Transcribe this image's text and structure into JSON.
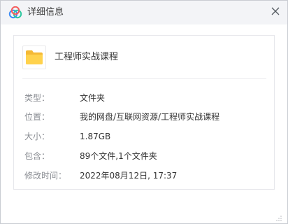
{
  "window": {
    "title": "详细信息",
    "app_icon": "baidu-netdisk-logo-icon",
    "close_icon": "close-icon"
  },
  "file": {
    "icon": "folder-icon",
    "name": "工程师实战课程"
  },
  "details": [
    {
      "label": "类型：",
      "value": "文件夹"
    },
    {
      "label": "位置：",
      "value": "我的网盘/互联网资源/工程师实战课程"
    },
    {
      "label": "大小：",
      "value": "1.87GB"
    },
    {
      "label": "包含：",
      "value": "89个文件,1个文件夹"
    },
    {
      "label": "修改时间：",
      "value": "2022年08月12日, 17:37"
    }
  ],
  "colors": {
    "titlebar_bg": "#f3f4f7",
    "folder_yellow": "#ffd24d",
    "label_gray": "#8a8d93",
    "value_text": "#333333",
    "logo_blue": "#3b8cf6",
    "logo_green": "#2fc8a0",
    "logo_red": "#f45b5b"
  }
}
